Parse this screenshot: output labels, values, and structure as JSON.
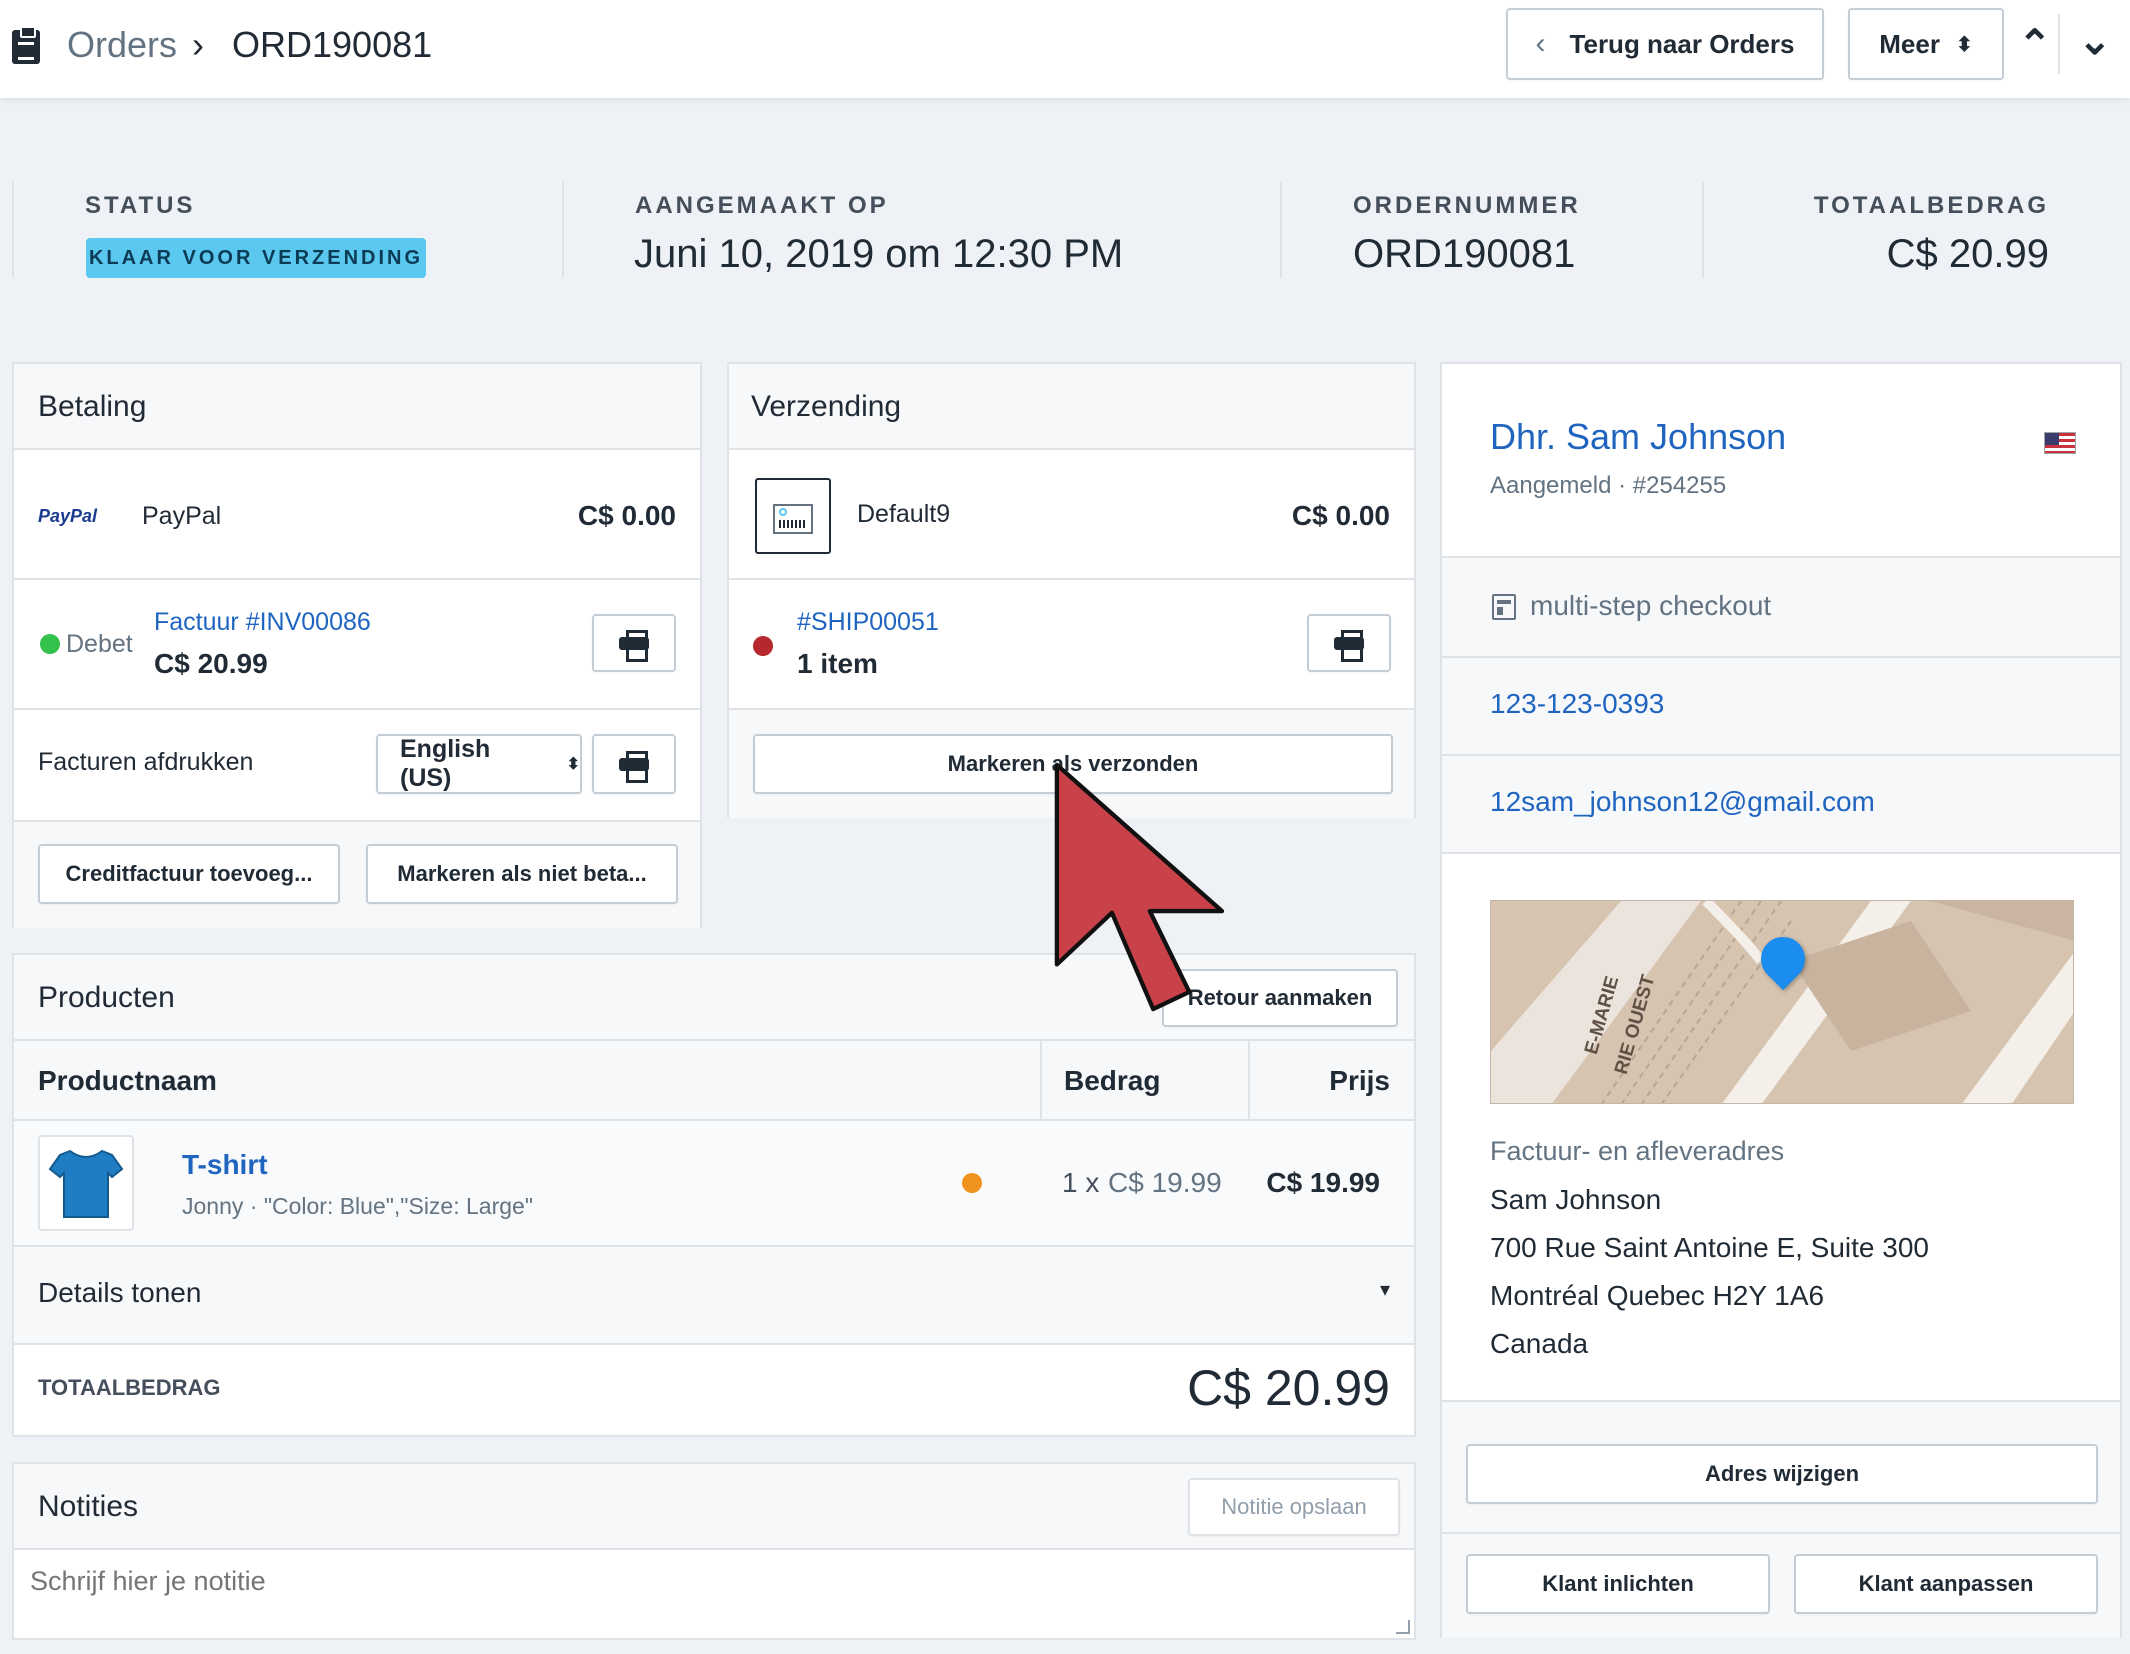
{
  "header": {
    "breadcrumb_root": "Orders",
    "breadcrumb_sep": "›",
    "breadcrumb_current": "ORD190081",
    "back_button": "Terug naar Orders",
    "more_button": "Meer",
    "back_chevron": "‹",
    "more_arrows": "⬍",
    "prev_chevron": "⌃",
    "next_chevron": "⌄"
  },
  "summary": {
    "status_label": "STATUS",
    "status_value": "KLAAR VOOR VERZENDING",
    "created_label": "AANGEMAAKT OP",
    "created_value": "Juni 10, 2019 om 12:30 PM",
    "order_number_label": "ORDERNUMMER",
    "order_number_value": "ORD190081",
    "total_label": "TOTAALBEDRAG",
    "total_value": "C$ 20.99"
  },
  "payment": {
    "title": "Betaling",
    "logo_text": "PayPal",
    "method": "PayPal",
    "method_amount": "C$ 0.00",
    "status": "Debet",
    "status_color": "#35c24c",
    "invoice_link": "Factuur #INV00086",
    "invoice_amount": "C$ 20.99",
    "print_invoices_label": "Facturen afdrukken",
    "language_select": "English (US)",
    "select_arrows": "⬍",
    "credit_button": "Creditfactuur toevoeg...",
    "unpaid_button": "Markeren als niet beta..."
  },
  "shipping": {
    "title": "Verzending",
    "method": "Default9",
    "method_amount": "C$ 0.00",
    "shipment_link": "#SHIP00051",
    "shipment_count": "1 item",
    "status_color": "#b5282d",
    "mark_shipped_button": "Markeren als verzonden"
  },
  "products": {
    "title": "Producten",
    "return_button": "Retour aanmaken",
    "col_name": "Productnaam",
    "col_amount": "Bedrag",
    "col_price": "Prijs",
    "items": [
      {
        "name": "T-shirt",
        "variant": "Jonny · \"Color: Blue\",\"Size: Large\"",
        "status_color": "#f0921e",
        "quantity": "1 x",
        "unit_price": "C$ 19.99",
        "price": "C$ 19.99"
      }
    ],
    "details_toggle": "Details tonen",
    "toggle_arrow": "▾",
    "total_label": "TOTAALBEDRAG",
    "total_value": "C$ 20.99"
  },
  "notes": {
    "title": "Notities",
    "save_button": "Notitie opslaan",
    "placeholder": "Schrijf hier je notitie"
  },
  "customer": {
    "name": "Dhr. Sam Johnson",
    "status": "Aangemeld · #254255",
    "checkout": "multi-step checkout",
    "phone": "123-123-0393",
    "email": "12sam_johnson12@gmail.com",
    "map_street_1": "E-MARIE",
    "map_street_2": "RIE OUEST",
    "address_label": "Factuur- en afleveradres",
    "address_lines": [
      "Sam Johnson",
      "700 Rue Saint Antoine E, Suite 300",
      "Montréal Quebec H2Y 1A6",
      "Canada"
    ],
    "change_address_button": "Adres wijzigen",
    "notify_button": "Klant inlichten",
    "edit_button": "Klant aanpassen"
  },
  "colors": {
    "link": "#1f65c0",
    "badge": "#5bc8f0",
    "cursor": "#c9424a",
    "map_pin": "#1b8cf0"
  }
}
